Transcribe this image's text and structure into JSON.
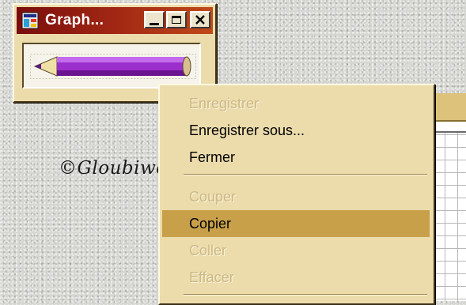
{
  "graph_window": {
    "title": "Graph...",
    "app_icon": "graph-app-icon",
    "buttons": {
      "minimize": "minimize-icon",
      "maximize": "maximize-icon",
      "close": "close-icon"
    },
    "tool_icon": "pencil-icon",
    "colors": {
      "titlebar_start": "#7a0d0c",
      "titlebar_end": "#c04a18",
      "pencil_body": "#9b2fcc"
    }
  },
  "signature": "©Gloubiweb",
  "context_menu": {
    "items": [
      {
        "label": "Enregistrer",
        "enabled": false
      },
      {
        "label": "Enregistrer sous...",
        "enabled": true
      },
      {
        "label": "Fermer",
        "enabled": true
      },
      {
        "label": "Couper",
        "enabled": false
      },
      {
        "label": "Copier",
        "enabled": true,
        "selected": true
      },
      {
        "label": "Coller",
        "enabled": false
      },
      {
        "label": "Effacer",
        "enabled": false
      }
    ],
    "colors": {
      "background": "#ecdcac",
      "highlight": "#c8a04a"
    }
  }
}
